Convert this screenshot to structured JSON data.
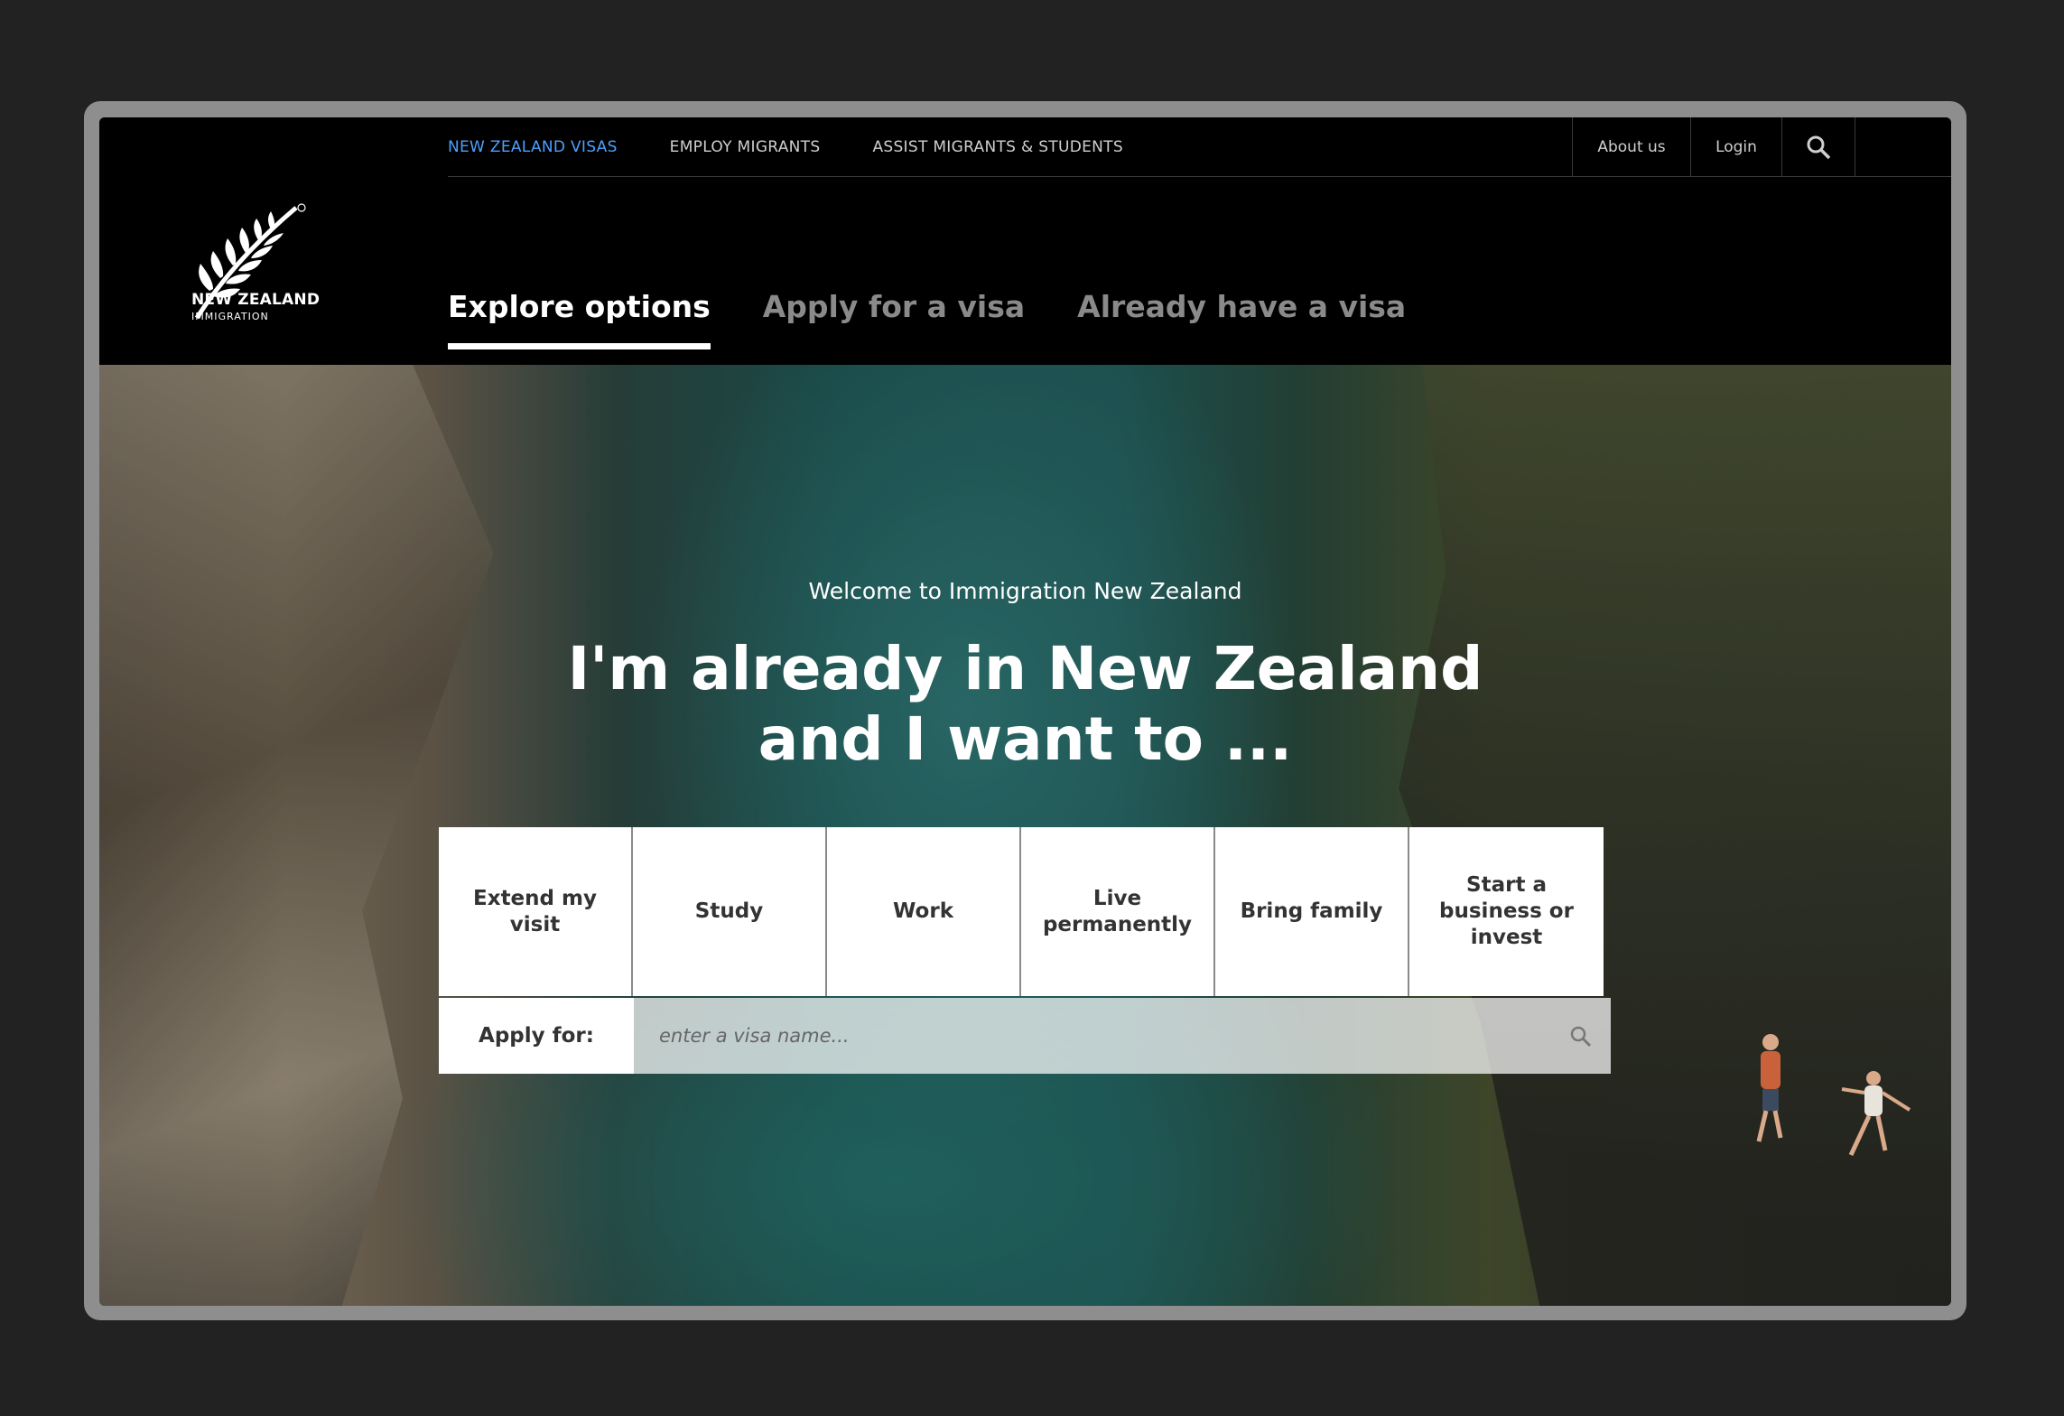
{
  "logo": {
    "line1": "NEW ZEALAND",
    "line2": "IMMIGRATION"
  },
  "top_nav": [
    {
      "label": "NEW ZEALAND VISAS",
      "active": true
    },
    {
      "label": "EMPLOY MIGRANTS",
      "active": false
    },
    {
      "label": "ASSIST MIGRANTS & STUDENTS",
      "active": false
    }
  ],
  "utility": {
    "about": "About us",
    "login": "Login",
    "search_icon": "search-icon"
  },
  "tabs": [
    {
      "label": "Explore options",
      "active": true
    },
    {
      "label": "Apply for a visa",
      "active": false
    },
    {
      "label": "Already have a visa",
      "active": false
    }
  ],
  "hero": {
    "welcome": "Welcome to Immigration New Zealand",
    "headline_line1": "I'm already in New Zealand",
    "headline_line2": "and I want to ..."
  },
  "options": [
    "Extend my visit",
    "Study",
    "Work",
    "Live permanently",
    "Bring family",
    "Start a business or invest"
  ],
  "apply": {
    "label": "Apply for:",
    "placeholder": "enter a visa name..."
  },
  "colors": {
    "nav_active": "#4aa1ff",
    "header_bg": "#000000",
    "page_bg": "#222222"
  }
}
